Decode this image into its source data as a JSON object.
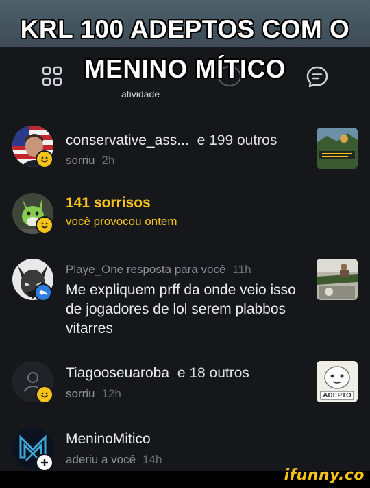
{
  "meme": {
    "line1": "KRL 100 ADEPTOS COM O",
    "line2": "MENINO MÍTICO"
  },
  "header": {
    "tab_label": "atividade",
    "icons": [
      "grid-icon",
      "chat-icon"
    ]
  },
  "notifications": [
    {
      "avatar": "avatar-flag-portrait",
      "badge": "smile",
      "name": "conservative_ass...",
      "suffix": "e 199 outros",
      "action": "sorriu",
      "time": "2h",
      "has_thumb": true
    },
    {
      "avatar": "avatar-green-fox",
      "badge": "smile",
      "headline": "141 sorrisos",
      "sub": "você provocou ontem"
    },
    {
      "avatar": "avatar-dark-creature",
      "badge": "reply",
      "author_line": "Playe_One resposta para você",
      "time": "11h",
      "comment": "Me expliquem prff da onde veio isso de jogadores de lol serem plabbos vitarres",
      "has_thumb": true
    },
    {
      "avatar": "avatar-default-user",
      "badge": "smile",
      "name": "Tiagooseuaroba",
      "suffix": "e 18 outros",
      "action": "sorriu",
      "time": "12h",
      "has_thumb": true,
      "thumb_caption": "ADEPTO"
    },
    {
      "avatar": "avatar-mm-logo",
      "badge": "plus",
      "name": "MeninoMitico",
      "action": "aderiu a você",
      "time": "14h"
    }
  ],
  "watermark": "ifunny.co",
  "colors": {
    "background": "#15171a",
    "accent_yellow": "#f6c21c",
    "reply_blue": "#2f7de1",
    "muted_text": "#8d9198"
  }
}
